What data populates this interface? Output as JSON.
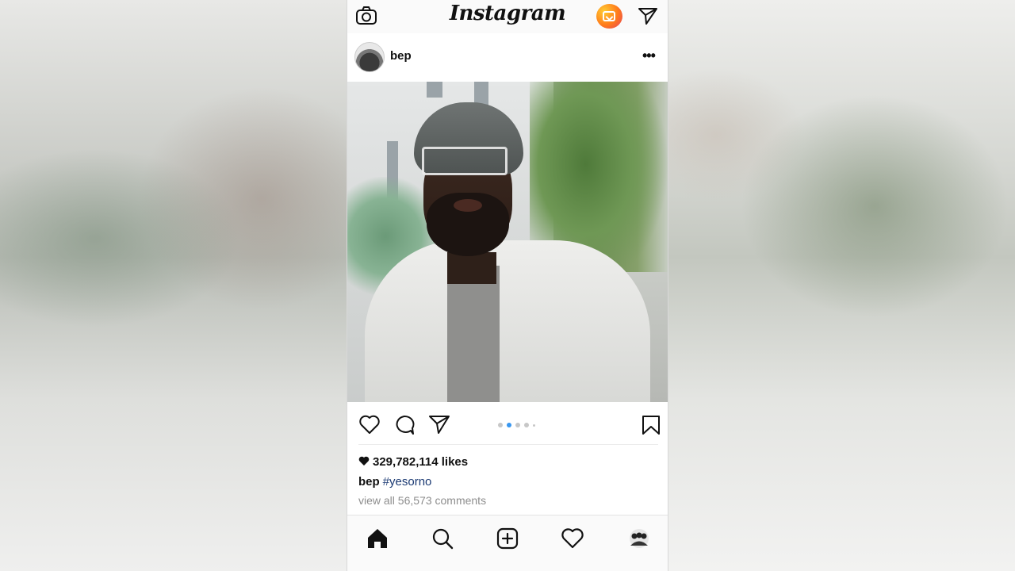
{
  "topbar": {
    "brand": "Instagram",
    "camera_icon": "camera-icon",
    "igtv_icon": "igtv-icon",
    "direct_icon": "paper-plane-icon"
  },
  "post": {
    "username": "bep",
    "more_icon": "more-options-icon",
    "more_label": "•••",
    "carousel": {
      "total": 5,
      "active_index": 1
    },
    "likes": "329,782,114 likes",
    "caption_user": "bep",
    "caption_tag": "#yesorno",
    "comments_link": "view all 56,573 comments"
  },
  "colors": {
    "carousel_active": "#3897f0",
    "hashtag": "#1b3a73",
    "muted_text": "#8e8e8e"
  },
  "bottom_nav": [
    "home-icon",
    "search-icon",
    "new-post-icon",
    "activity-heart-icon",
    "profile-avatar-icon"
  ]
}
